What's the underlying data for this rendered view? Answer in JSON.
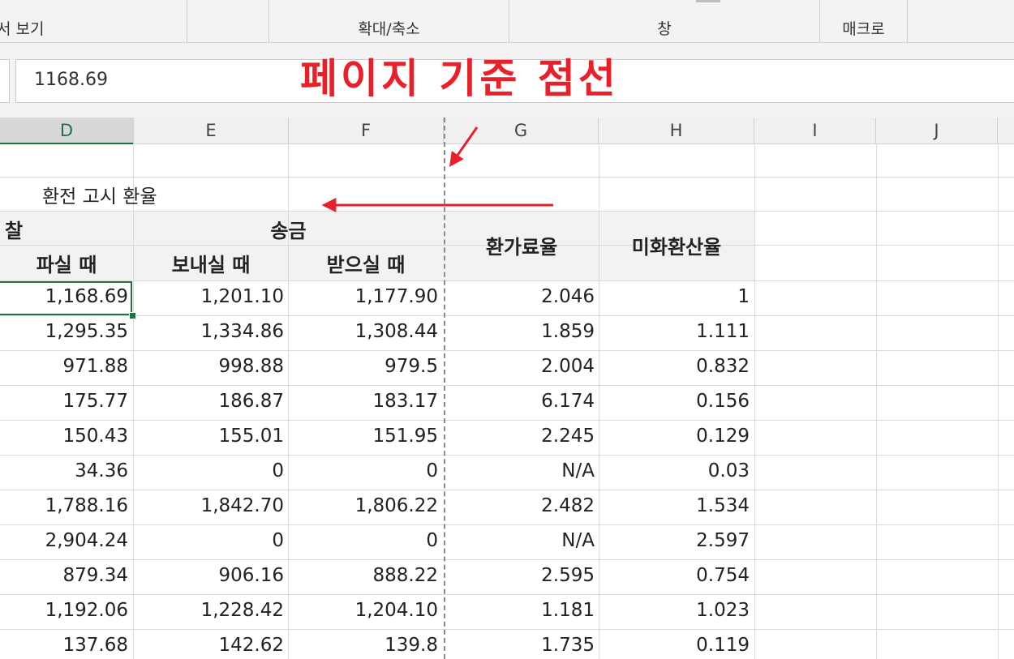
{
  "ribbon": {
    "groups": [
      "서 보기",
      "확대/축소",
      "창",
      "매크로"
    ]
  },
  "formula_bar": {
    "value": "1168.69"
  },
  "annotation": {
    "title": "페이지 기준 점선",
    "color": "#e8202a"
  },
  "columns": [
    "D",
    "E",
    "F",
    "G",
    "H",
    "I",
    "J"
  ],
  "table": {
    "title": "환전 고시 환율",
    "header_cash_fragment": "찰",
    "header_remit": "송금",
    "header_exchange_fee": "환가료율",
    "header_usd_rate": "미화환산율",
    "sub_sell": "파실 때",
    "sub_send": "보내실 때",
    "sub_receive": "받으실 때",
    "rows": [
      [
        "1,168.69",
        "1,201.10",
        "1,177.90",
        "2.046",
        "1"
      ],
      [
        "1,295.35",
        "1,334.86",
        "1,308.44",
        "1.859",
        "1.111"
      ],
      [
        "971.88",
        "998.88",
        "979.5",
        "2.004",
        "0.832"
      ],
      [
        "175.77",
        "186.87",
        "183.17",
        "6.174",
        "0.156"
      ],
      [
        "150.43",
        "155.01",
        "151.95",
        "2.245",
        "0.129"
      ],
      [
        "34.36",
        "0",
        "0",
        "N/A",
        "0.03"
      ],
      [
        "1,788.16",
        "1,842.70",
        "1,806.22",
        "2.482",
        "1.534"
      ],
      [
        "2,904.24",
        "0",
        "0",
        "N/A",
        "2.597"
      ],
      [
        "879.34",
        "906.16",
        "888.22",
        "2.595",
        "0.754"
      ],
      [
        "1,192.06",
        "1,228.42",
        "1,204.10",
        "1.181",
        "1.023"
      ],
      [
        "137.68",
        "142.62",
        "139.8",
        "1.735",
        "0.119"
      ]
    ]
  },
  "accent_colors": {
    "excel_green": "#217346",
    "page_break": "#8a8a8a"
  }
}
